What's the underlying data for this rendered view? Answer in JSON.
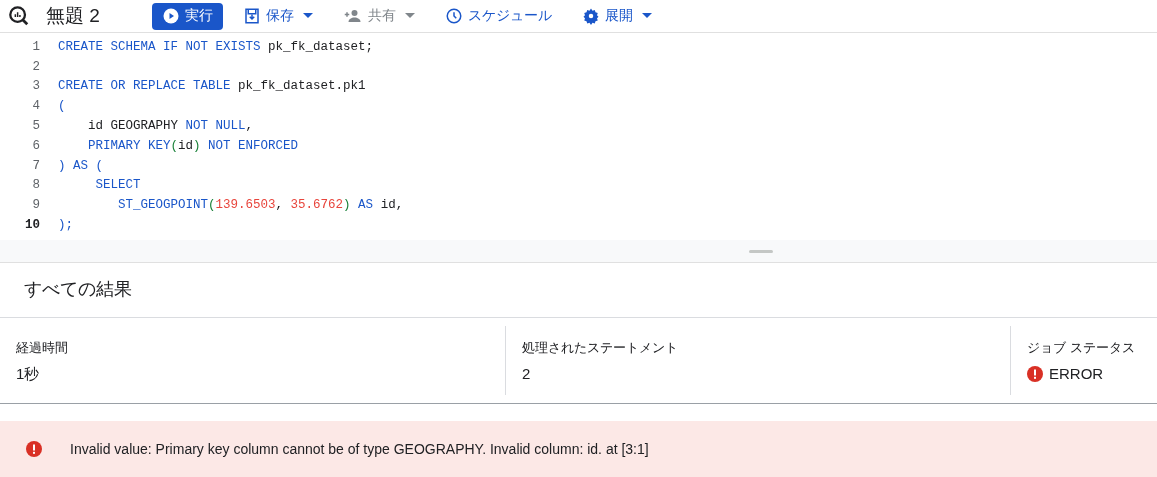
{
  "toolbar": {
    "title": "無題 2",
    "buttons": [
      {
        "label": "実行",
        "primary": true,
        "dropdown": false,
        "disabled": false
      },
      {
        "label": "保存",
        "primary": false,
        "dropdown": true,
        "disabled": false
      },
      {
        "label": "共有",
        "primary": false,
        "dropdown": true,
        "disabled": true
      },
      {
        "label": "スケジュール",
        "primary": false,
        "dropdown": false,
        "disabled": false
      },
      {
        "label": "展開",
        "primary": false,
        "dropdown": true,
        "disabled": false
      }
    ]
  },
  "editor": {
    "lines": [
      {
        "number": "1",
        "current": false,
        "tokens": [
          {
            "text": "CREATE SCHEMA IF NOT EXISTS",
            "kind": "keyword"
          },
          {
            "text": " pk_fk_dataset;",
            "kind": "plain"
          }
        ]
      },
      {
        "number": "2",
        "current": false
      },
      {
        "number": "3",
        "current": false,
        "tokens": [
          {
            "text": "CREATE OR REPLACE TABLE",
            "kind": "keyword"
          },
          {
            "text": " pk_fk_dataset.pk1",
            "kind": "plain"
          }
        ]
      },
      {
        "number": "4",
        "current": false,
        "tokens": [
          {
            "text": "(",
            "kind": "keyword"
          }
        ]
      },
      {
        "number": "5",
        "current": false,
        "tokens": [
          {
            "text": "    id GEOGRAPHY",
            "kind": "plain"
          },
          {
            "text": " NOT NULL",
            "kind": "keyword"
          },
          {
            "text": ",",
            "kind": "plain"
          }
        ]
      },
      {
        "number": "6",
        "current": false,
        "tokens": [
          {
            "text": "    PRIMARY KEY",
            "kind": "keyword"
          },
          {
            "text": "(",
            "kind": "paren"
          },
          {
            "text": "id",
            "kind": "plain"
          },
          {
            "text": ")",
            "kind": "paren"
          },
          {
            "text": " NOT ENFORCED",
            "kind": "keyword"
          }
        ]
      },
      {
        "number": "7",
        "current": false,
        "tokens": [
          {
            "text": ") AS (",
            "kind": "keyword"
          }
        ]
      },
      {
        "number": "8",
        "current": false,
        "tokens": [
          {
            "text": "     SELECT",
            "kind": "keyword"
          }
        ]
      },
      {
        "number": "9",
        "current": false,
        "tokens": [
          {
            "text": "        ST_GEOGPOINT",
            "kind": "keyword"
          },
          {
            "text": "(",
            "kind": "paren"
          },
          {
            "text": "139.6503",
            "kind": "number"
          },
          {
            "text": ", ",
            "kind": "plain"
          },
          {
            "text": "35.6762",
            "kind": "number"
          },
          {
            "text": ")",
            "kind": "paren"
          },
          {
            "text": " AS",
            "kind": "keyword"
          },
          {
            "text": " id,",
            "kind": "plain"
          }
        ]
      },
      {
        "number": "10",
        "current": true,
        "tokens": [
          {
            "text": ");",
            "kind": "keyword"
          }
        ]
      }
    ]
  },
  "results": {
    "title": "すべての結果",
    "stats": [
      {
        "label": "経過時間",
        "value": "1秒",
        "error": false
      },
      {
        "label": "処理されたステートメント",
        "value": "2",
        "error": false
      },
      {
        "label": "ジョブ ステータス",
        "value": "ERROR",
        "error": true
      }
    ],
    "error_message": "Invalid value: Primary key column cannot be of type GEOGRAPHY. Invalid column: id. at [3:1]"
  }
}
